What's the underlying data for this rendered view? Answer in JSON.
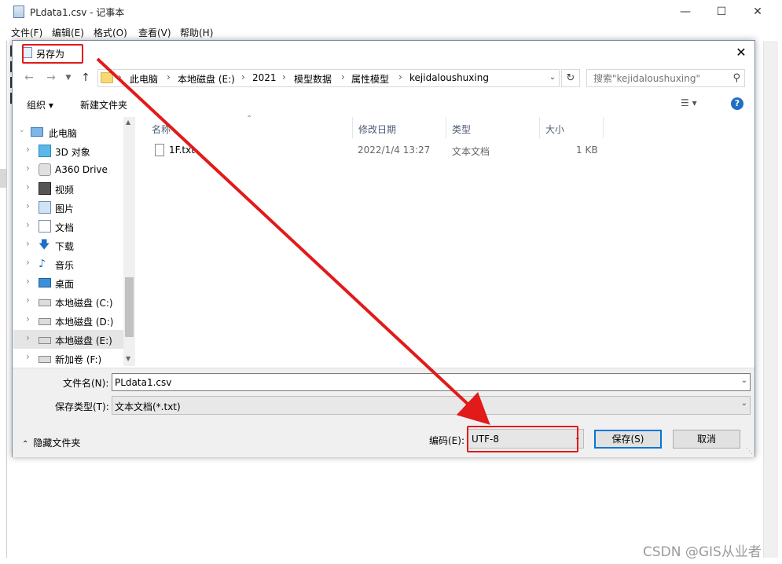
{
  "notepad": {
    "title": "PLdata1.csv - 记事本",
    "menu": [
      "文件(F)",
      "编辑(E)",
      "格式(O)",
      "查看(V)",
      "帮助(H)"
    ]
  },
  "dialog": {
    "title": "另存为",
    "address_crumbs": [
      "此电脑",
      "本地磁盘 (E:)",
      "2021",
      "模型数据",
      "属性模型",
      "kejidaloushuxing"
    ],
    "search_placeholder": "搜索\"kejidaloushuxing\"",
    "toolbar": {
      "organize": "组织 ▾",
      "new_folder": "新建文件夹"
    },
    "tree": [
      {
        "label": "此电脑",
        "icon": "computer-icon",
        "selected": false
      },
      {
        "label": "3D 对象",
        "icon": "cube-icon",
        "selected": false
      },
      {
        "label": "A360 Drive",
        "icon": "cloud-drive-icon",
        "selected": false
      },
      {
        "label": "视频",
        "icon": "video-icon",
        "selected": false
      },
      {
        "label": "图片",
        "icon": "pictures-icon",
        "selected": false
      },
      {
        "label": "文档",
        "icon": "documents-icon",
        "selected": false
      },
      {
        "label": "下载",
        "icon": "download-icon",
        "selected": false
      },
      {
        "label": "音乐",
        "icon": "music-icon",
        "selected": false
      },
      {
        "label": "桌面",
        "icon": "desktop-icon",
        "selected": false
      },
      {
        "label": "本地磁盘 (C:)",
        "icon": "drive-icon",
        "selected": false
      },
      {
        "label": "本地磁盘 (D:)",
        "icon": "drive-icon",
        "selected": false
      },
      {
        "label": "本地磁盘 (E:)",
        "icon": "drive-icon",
        "selected": true
      },
      {
        "label": "新加卷 (F:)",
        "icon": "drive-icon",
        "selected": false
      }
    ],
    "columns": {
      "name": "名称",
      "modified": "修改日期",
      "type": "类型",
      "size": "大小"
    },
    "files": [
      {
        "name": "1F.txt",
        "modified": "2022/1/4 13:27",
        "type": "文本文档",
        "size": "1 KB"
      }
    ],
    "filename_label": "文件名(N):",
    "filename_value": "PLdata1.csv",
    "savetype_label": "保存类型(T):",
    "savetype_value": "文本文档(*.txt)",
    "hide_folders": "隐藏文件夹",
    "encoding_label": "编码(E):",
    "encoding_value": "UTF-8",
    "save_button": "保存(S)",
    "cancel_button": "取消"
  },
  "watermark": "CSDN @GIS从业者",
  "colors": {
    "annotation_red": "#e21a1a",
    "accent": "#0078d7",
    "selection": "#e5e5e5"
  }
}
